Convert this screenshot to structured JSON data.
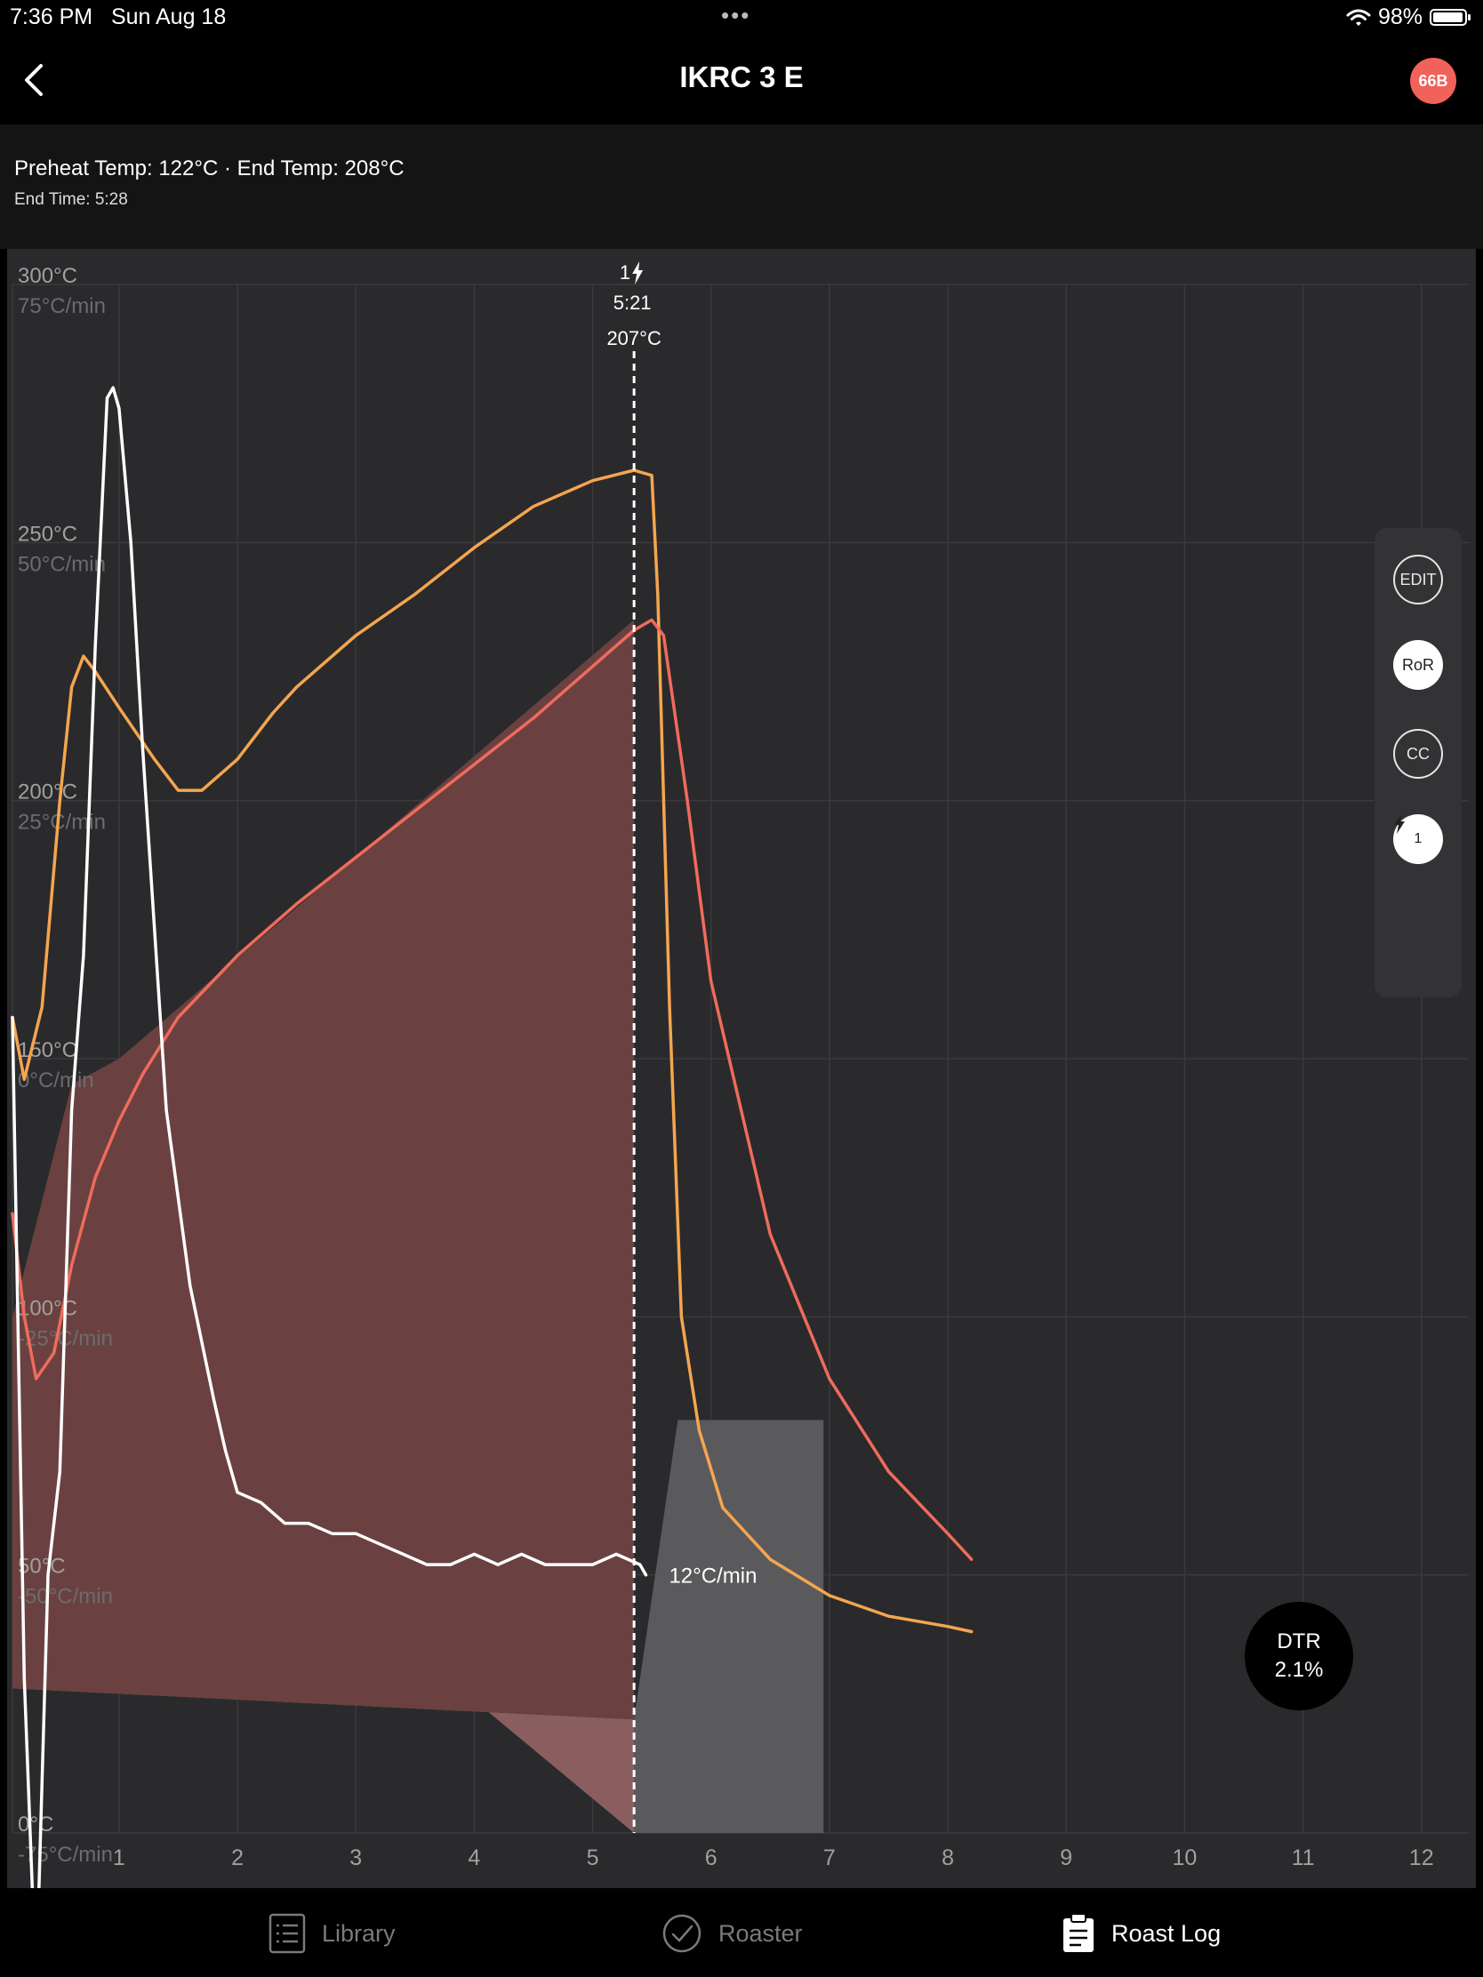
{
  "status_bar": {
    "time": "7:36 PM",
    "date": "Sun Aug 18",
    "battery": "98%",
    "wifi_icon": "wifi-icon",
    "battery_icon": "battery-icon"
  },
  "nav": {
    "title": "IKRC 3 E",
    "badge": "66B",
    "back_icon": "chevron-left-icon"
  },
  "info": {
    "line1": "Preheat Temp: 122°C · End Temp: 208°C",
    "line2": "End Time: 5:28"
  },
  "chart_data": {
    "type": "line",
    "title": "",
    "x_ticks": [
      "1",
      "2",
      "3",
      "4",
      "5",
      "6",
      "7",
      "8",
      "9",
      "10",
      "11",
      "12"
    ],
    "xlim": [
      0.1,
      12.4
    ],
    "y_temp_labels": [
      "300°C",
      "250°C",
      "200°C",
      "150°C",
      "100°C",
      "50°C",
      "0°C"
    ],
    "y_ror_labels": [
      "75°C/min",
      "50°C/min",
      "25°C/min",
      "0°C/min",
      "-25°C/min",
      "-50°C/min",
      "-75°C/min"
    ],
    "ylim_temp": [
      0,
      300
    ],
    "ylim_ror": [
      -75,
      75
    ],
    "grid": true,
    "marker": {
      "label": "1",
      "time": "5:21",
      "temp": "207°C",
      "x": 5.35
    },
    "ror_end_label": "12°C/min",
    "series": [
      {
        "color": "#f5a550",
        "x": [
          0.1,
          0.2,
          0.35,
          0.5,
          0.6,
          0.7,
          0.8,
          1.0,
          1.3,
          1.5,
          1.7,
          2.0,
          2.3,
          2.5,
          3.0,
          3.5,
          4.0,
          4.5,
          5.0,
          5.35,
          5.5,
          5.55,
          5.65,
          5.75,
          5.9,
          6.1,
          6.5,
          7.0,
          7.5,
          8.0,
          8.2
        ],
        "y": [
          158,
          146,
          160,
          200,
          222,
          228,
          225,
          218,
          208,
          202,
          202,
          208,
          217,
          222,
          232,
          240,
          249,
          257,
          262,
          264,
          263,
          240,
          160,
          100,
          78,
          63,
          53,
          46,
          42,
          40,
          39
        ]
      },
      {
        "color": "#f06b5c",
        "x": [
          0.1,
          0.2,
          0.3,
          0.45,
          0.6,
          0.8,
          1.0,
          1.2,
          1.5,
          2.0,
          2.5,
          3.0,
          3.5,
          4.0,
          4.5,
          5.0,
          5.35,
          5.5,
          5.6,
          5.8,
          6.0,
          6.5,
          7.0,
          7.5,
          8.0,
          8.2
        ],
        "y": [
          120,
          100,
          88,
          93,
          110,
          127,
          138,
          147,
          158,
          170,
          180,
          189,
          198,
          207,
          216,
          226,
          233,
          235,
          232,
          200,
          165,
          116,
          88,
          70,
          58,
          53
        ]
      },
      {
        "color": "#ffffff",
        "x": [
          0.1,
          0.2,
          0.3,
          0.4,
          0.5,
          0.6,
          0.7,
          0.8,
          0.9,
          0.95,
          1.0,
          1.1,
          1.2,
          1.4,
          1.6,
          1.8,
          1.9,
          2.0,
          2.2,
          2.4,
          2.6,
          2.8,
          3.0,
          3.2,
          3.4,
          3.6,
          3.8,
          4.0,
          4.2,
          4.4,
          4.6,
          4.8,
          5.0,
          5.2,
          5.4,
          5.45
        ],
        "y": [
          4,
          -60,
          -90,
          -50,
          -40,
          -5,
          10,
          40,
          64,
          65,
          63,
          50,
          30,
          -5,
          -22,
          -33,
          -38,
          -42,
          -43,
          -45,
          -45,
          -46,
          -46,
          -47,
          -48,
          -49,
          -49,
          -48,
          -49,
          -48,
          -49,
          -49,
          -49,
          -48,
          -49,
          -50
        ]
      }
    ],
    "ror_axis_series_index": 2
  },
  "side_controls": {
    "edit": "EDIT",
    "ror": "RoR",
    "cc": "CC",
    "first_crack": "1"
  },
  "dtr": {
    "label": "DTR",
    "value": "2.1%"
  },
  "tabs": [
    {
      "label": "Library",
      "icon": "list-icon"
    },
    {
      "label": "Roaster",
      "icon": "check-circle-icon"
    },
    {
      "label": "Roast Log",
      "icon": "clipboard-icon",
      "active": true
    }
  ]
}
